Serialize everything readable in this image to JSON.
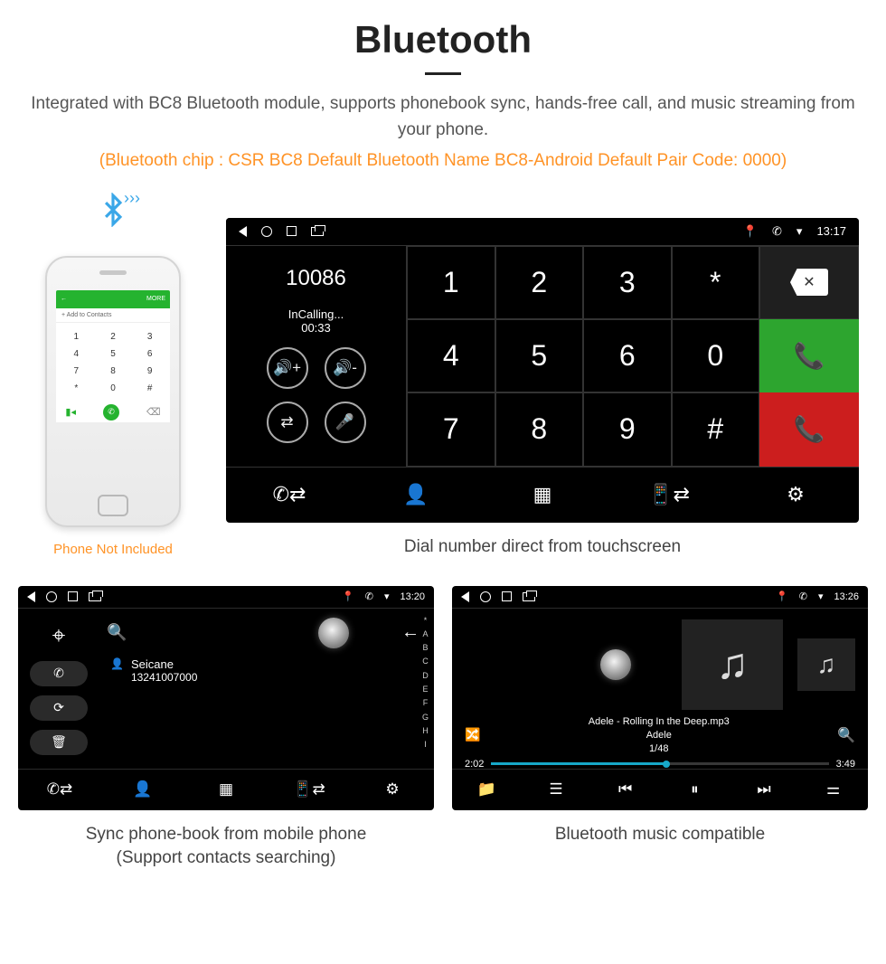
{
  "header": {
    "title": "Bluetooth",
    "subtitle": "Integrated with BC8 Bluetooth module, supports phonebook sync, hands-free call, and music streaming from your phone.",
    "spec": "(Bluetooth chip : CSR BC8    Default Bluetooth Name BC8-Android    Default Pair Code: 0000)"
  },
  "phone": {
    "topbar_back": "←",
    "topbar_more": "MORE",
    "add_contacts": "+   Add to Contacts",
    "keys": [
      "1",
      "2",
      "3",
      "4",
      "5",
      "6",
      "7",
      "8",
      "9",
      "*",
      "0",
      "#"
    ],
    "caption": "Phone Not Included"
  },
  "hu": {
    "time": "13:17",
    "number": "10086",
    "status": "InCalling...",
    "duration": "00:33",
    "keypad": [
      "1",
      "2",
      "3",
      "*",
      "4",
      "5",
      "6",
      "0",
      "7",
      "8",
      "9",
      "#"
    ],
    "caption": "Dial number direct from touchscreen"
  },
  "pb": {
    "time": "13:20",
    "contact_name": "Seicane",
    "contact_num": "13241007000",
    "index": [
      "*",
      "A",
      "B",
      "C",
      "D",
      "E",
      "F",
      "G",
      "H",
      "I"
    ],
    "caption_l1": "Sync phone-book from mobile phone",
    "caption_l2": "(Support contacts searching)"
  },
  "music": {
    "time": "13:26",
    "track": "Adele - Rolling In the Deep.mp3",
    "artist": "Adele",
    "counter": "1/48",
    "elapsed": "2:02",
    "total": "3:49",
    "caption": "Bluetooth music compatible"
  }
}
